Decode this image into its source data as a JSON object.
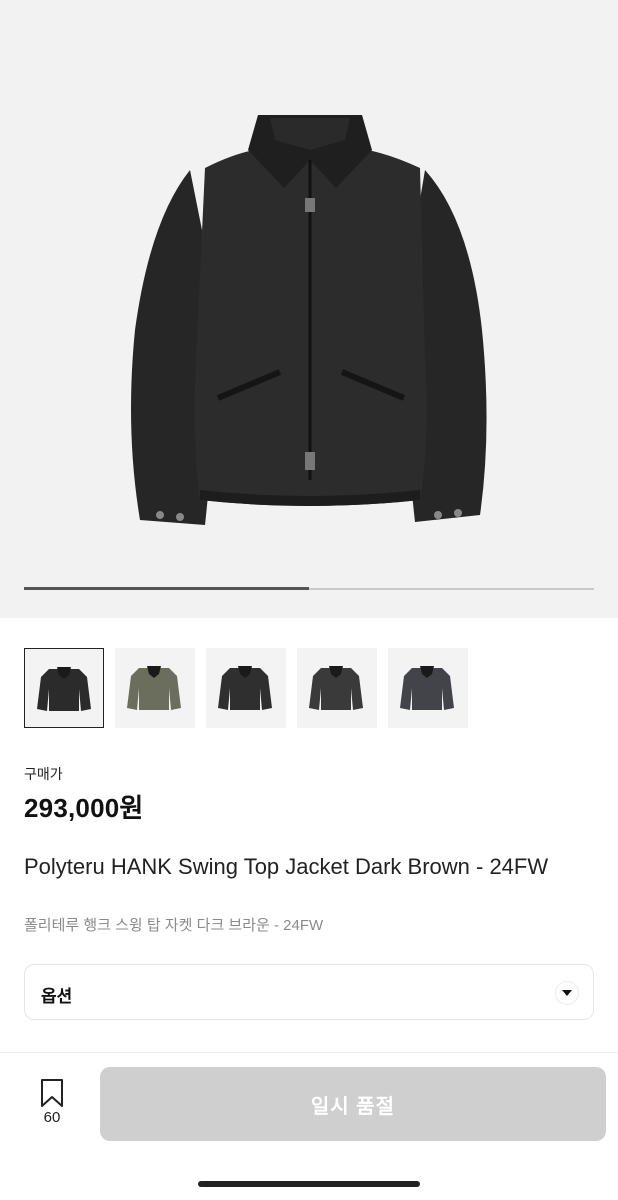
{
  "gallery": {
    "image_count": 2,
    "current_index": 1,
    "progress_fraction": 0.5,
    "thumbnails": [
      {
        "name": "thumb-1",
        "color": "#2b2b2b",
        "selected": true
      },
      {
        "name": "thumb-2",
        "color": "#6b6e5d",
        "selected": false
      },
      {
        "name": "thumb-3",
        "color": "#2f2f2f",
        "selected": false
      },
      {
        "name": "thumb-4",
        "color": "#3a3a3a",
        "selected": false
      },
      {
        "name": "thumb-5",
        "color": "#42444a",
        "selected": false
      }
    ]
  },
  "product": {
    "price_label": "구매가",
    "price": "293,000원",
    "title": "Polyteru HANK Swing Top Jacket Dark Brown - 24FW",
    "subtitle": "폴리테루 행크 스윙 탑 자켓 다크 브라운 - 24FW"
  },
  "option": {
    "label": "옵션",
    "icon": "chevron-down-icon"
  },
  "footer": {
    "wishlist_icon": "bookmark-icon",
    "wishlist_count": "60",
    "buy_button_label": "일시 품절",
    "buy_button_color": "#cfcfcf"
  }
}
